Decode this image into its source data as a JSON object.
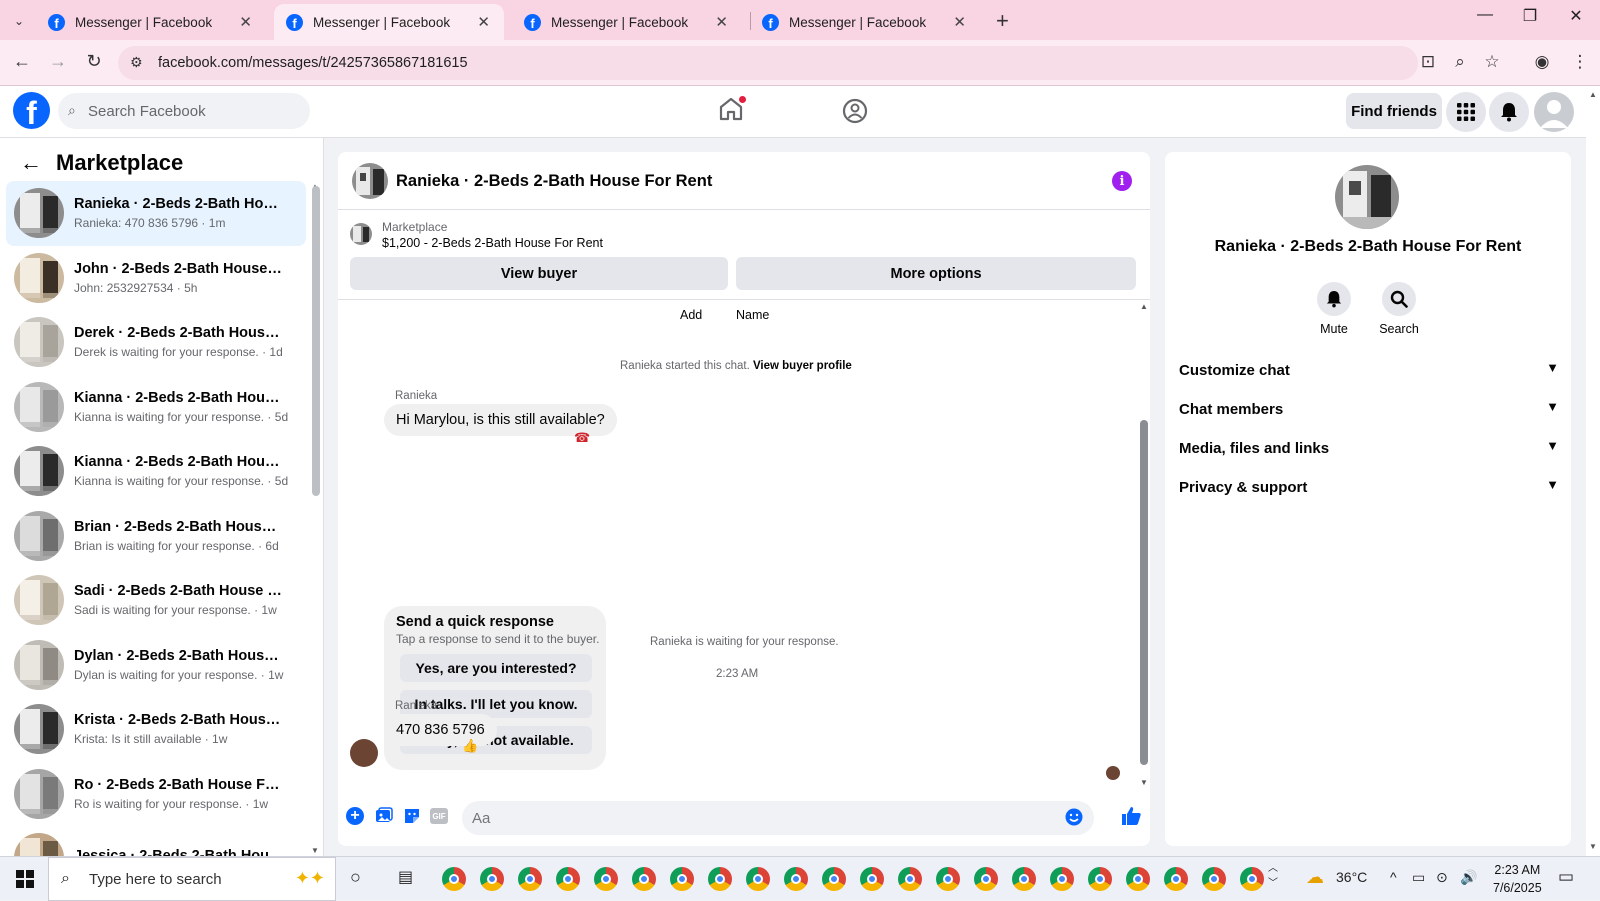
{
  "browser": {
    "tabs": [
      {
        "title": "Messenger | Facebook",
        "active": false
      },
      {
        "title": "Messenger | Facebook",
        "active": true
      },
      {
        "title": "Messenger | Facebook",
        "active": false
      },
      {
        "title": "Messenger | Facebook",
        "active": false
      }
    ],
    "url": "facebook.com/messages/t/24257365867181615"
  },
  "header": {
    "search_placeholder": "Search Facebook",
    "find_friends": "Find friends"
  },
  "sidebar": {
    "title": "Marketplace",
    "conversations": [
      {
        "name": "Ranieka · 2-Beds 2-Bath House For Rent",
        "preview": "Ranieka: 470 836 5796 · 1m",
        "active": true
      },
      {
        "name": "John · 2-Beds 2-Bath House For Rent",
        "preview": "John: 2532927534 · 5h"
      },
      {
        "name": "Derek · 2-Beds 2-Bath House For Rent",
        "preview": "Derek is waiting for your response. · 1d"
      },
      {
        "name": "Kianna · 2-Beds 2-Bath House For Rent",
        "preview": "Kianna is waiting for your response. · 5d"
      },
      {
        "name": "Kianna · 2-Beds 2-Bath House For Rent",
        "preview": "Kianna is waiting for your response. · 5d"
      },
      {
        "name": "Brian · 2-Beds 2-Bath House For Rent",
        "preview": "Brian is waiting for your response. · 6d"
      },
      {
        "name": "Sadi · 2-Beds 2-Bath House For Rent",
        "preview": "Sadi is waiting for your response. · 1w"
      },
      {
        "name": "Dylan · 2-Beds 2-Bath House For Rent",
        "preview": "Dylan is waiting for your response. · 1w"
      },
      {
        "name": "Krista · 2-Beds 2-Bath House For Rent",
        "preview": "Krista: Is it still available · 1w"
      },
      {
        "name": "Ro · 2-Beds 2-Bath House For Rent",
        "preview": "Ro is waiting for your response. · 1w"
      },
      {
        "name": "Jessica · 2-Beds 2-Bath House For Rent",
        "preview": ""
      }
    ]
  },
  "chat": {
    "title": "Ranieka · 2-Beds 2-Bath House For Rent",
    "listing_source": "Marketplace",
    "listing_price": "$1,200 - 2-Beds 2-Bath House For Rent",
    "view_buyer": "View buyer",
    "more_options": "More options",
    "top_actions": [
      "Add",
      "Name"
    ],
    "started_text": "Ranieka started this chat.",
    "view_buyer_profile": "View buyer profile",
    "sender": "Ranieka",
    "msg1": "Hi Marylou, is this still available?",
    "quick_title": "Send a quick response",
    "quick_sub": "Tap a response to send it to the buyer.",
    "quick_replies": [
      "Yes, are you interested?",
      "In talks. I'll let you know.",
      "Sorry, it's not available."
    ],
    "waiting": "Ranieka is waiting for your response.",
    "timestamp": "2:23 AM",
    "msg2": "470 836 5796",
    "composer_placeholder": "Aa",
    "gif_label": "GIF"
  },
  "details": {
    "name": "Ranieka · 2-Beds 2-Bath House For Rent",
    "mute": "Mute",
    "search": "Search",
    "sections": [
      "Customize chat",
      "Chat members",
      "Media, files and links",
      "Privacy & support"
    ]
  },
  "taskbar": {
    "search_placeholder": "Type here to search",
    "weather": "36°C",
    "time": "2:23 AM",
    "date": "7/6/2025"
  }
}
